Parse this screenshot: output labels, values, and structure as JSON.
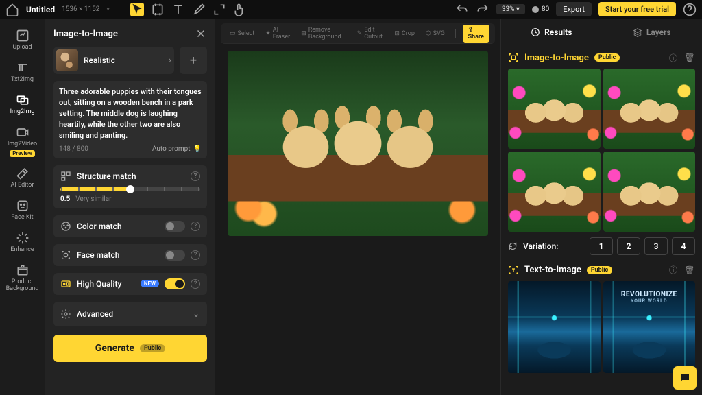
{
  "topbar": {
    "doc_title": "Untitled",
    "doc_dims": "1536 × 1152",
    "zoom": "33%",
    "credits": "80",
    "export": "Export",
    "trial": "Start your free trial"
  },
  "rail": {
    "items": [
      {
        "label": "Upload"
      },
      {
        "label": "Txt2Img"
      },
      {
        "label": "Img2Img"
      },
      {
        "label": "Img2Video",
        "badge": "Preview"
      },
      {
        "label": "AI Editor"
      },
      {
        "label": "Face Kit"
      },
      {
        "label": "Enhance"
      },
      {
        "label": "Product Background"
      }
    ]
  },
  "i2i": {
    "title": "Image-to-Image",
    "style": "Realistic",
    "prompt": "Three adorable puppies with their tongues out, sitting on a wooden bench in a park setting. The middle dog is laughing heartily, while the other two are also smiling and panting.",
    "char_count": "148 / 800",
    "auto_prompt": "Auto prompt",
    "structure": {
      "label": "Structure match",
      "value": "0.5",
      "hint": "Very similar"
    },
    "color": {
      "label": "Color match"
    },
    "face": {
      "label": "Face match"
    },
    "hq": {
      "label": "High Quality",
      "badge": "NEW"
    },
    "advanced": "Advanced",
    "generate": "Generate",
    "generate_badge": "Public"
  },
  "canvas_toolbar": {
    "select": "Select",
    "ai_eraser": "AI Eraser",
    "remove_bg": "Remove Background",
    "edit_cutout": "Edit Cutout",
    "crop": "Crop",
    "svg": "SVG",
    "share": "Share"
  },
  "right": {
    "tab_results": "Results",
    "tab_layers": "Layers",
    "sec_i2i": {
      "title": "Image-to-Image",
      "badge": "Public"
    },
    "variation": {
      "label": "Variation:",
      "opts": [
        "1",
        "2",
        "3",
        "4"
      ]
    },
    "sec_t2i": {
      "title": "Text-to-Image",
      "badge": "Public",
      "rev_line1": "REVOLUTIONIZE",
      "rev_line2": "YOUR WORLD"
    }
  }
}
